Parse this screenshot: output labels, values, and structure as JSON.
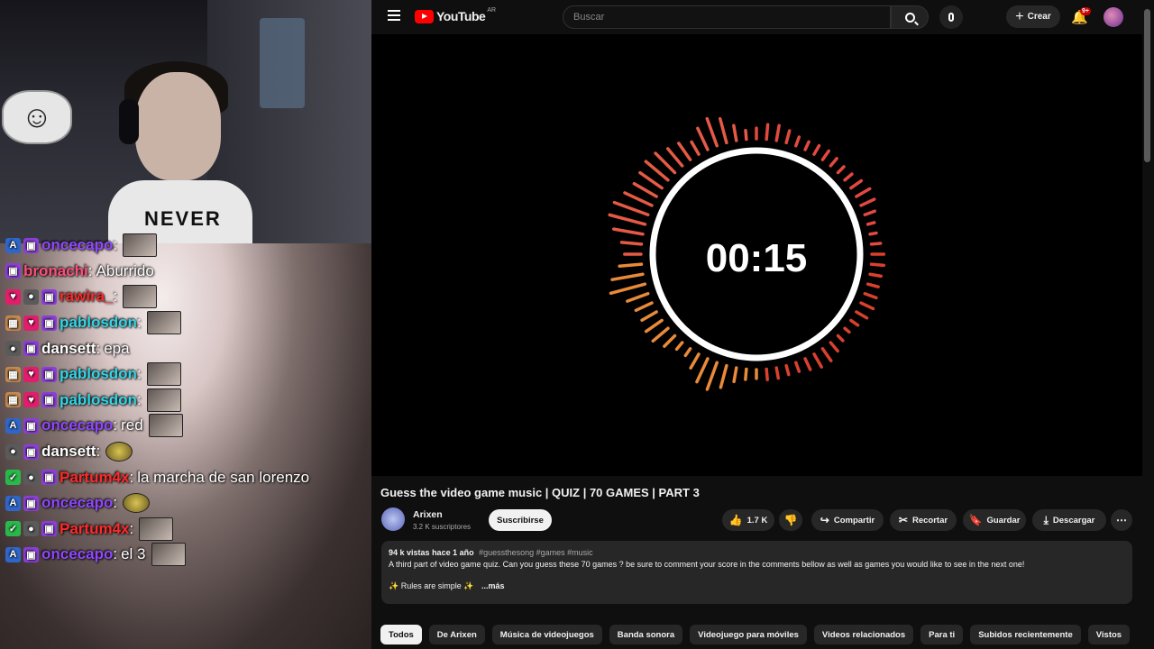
{
  "stream": {
    "shirt_text": "NEVER",
    "chat": [
      {
        "badges": [
          "sub",
          "twitch"
        ],
        "user": "oncecapo",
        "color": "#9147ff",
        "text": "",
        "emote": "photo"
      },
      {
        "badges": [
          "twitch"
        ],
        "user": "bronachi",
        "color": "#ff4f7a",
        "text": "Aburrido",
        "emote": ""
      },
      {
        "badges": [
          "pink",
          "dark",
          "twitch"
        ],
        "user": "rawira_",
        "color": "#ff2a2a",
        "text": "",
        "emote": "photo"
      },
      {
        "badges": [
          "gift",
          "pink",
          "twitch"
        ],
        "user": "pablosdon",
        "color": "#31d6e8",
        "text": "",
        "emote": "photo"
      },
      {
        "badges": [
          "dark",
          "twitch"
        ],
        "user": "dansett",
        "color": "#ffffff",
        "text": "epa",
        "emote": ""
      },
      {
        "badges": [
          "gift",
          "pink",
          "twitch"
        ],
        "user": "pablosdon",
        "color": "#31d6e8",
        "text": "",
        "emote": "photo"
      },
      {
        "badges": [
          "gift",
          "pink",
          "twitch"
        ],
        "user": "pablosdon",
        "color": "#31d6e8",
        "text": "",
        "emote": "photo"
      },
      {
        "badges": [
          "sub",
          "twitch"
        ],
        "user": "oncecapo",
        "color": "#9147ff",
        "text": "red",
        "emote": "photo"
      },
      {
        "badges": [
          "dark",
          "twitch"
        ],
        "user": "dansett",
        "color": "#ffffff",
        "text": "",
        "emote": "small"
      },
      {
        "badges": [
          "green",
          "dark",
          "twitch"
        ],
        "user": "Partum4x",
        "color": "#ff2a2a",
        "text": "la marcha de san lorenzo",
        "emote": ""
      },
      {
        "badges": [
          "sub",
          "twitch"
        ],
        "user": "oncecapo",
        "color": "#9147ff",
        "text": "",
        "emote": "small"
      },
      {
        "badges": [
          "green",
          "dark",
          "twitch"
        ],
        "user": "Partum4x",
        "color": "#ff2a2a",
        "text": "",
        "emote": "photo"
      },
      {
        "badges": [
          "sub",
          "twitch"
        ],
        "user": "oncecapo",
        "color": "#9147ff",
        "text": "el 3",
        "emote": "photo"
      }
    ]
  },
  "youtube": {
    "logo_text": "YouTube",
    "logo_country": "AR",
    "search_placeholder": "Buscar",
    "create_label": "Crear",
    "notif_count": "9+",
    "timer": "00:15",
    "video_title": "Guess the video game music | QUIZ | 70 GAMES | PART 3",
    "channel_name": "Arixen",
    "channel_subs": "3.2 K suscriptores",
    "subscribe_label": "Suscribirse",
    "likes": "1.7 K",
    "share_label": "Compartir",
    "clip_label": "Recortar",
    "save_label": "Guardar",
    "download_label": "Descargar",
    "views": "94 k vistas",
    "uploaded": "hace 1 año",
    "tags": "#guessthesong #games #music",
    "description": "A third part of video game quiz. Can you guess these 70 games ? be sure to comment your score in the comments bellow as well as games you would like to see in the next one!",
    "description_line2": "Rules are simple",
    "more_label": "...más",
    "chips": [
      "Todos",
      "De Arixen",
      "Música de videojuegos",
      "Banda sonora",
      "Videojuego para móviles",
      "Videos relacionados",
      "Para ti",
      "Subidos recientemente",
      "Vistos"
    ]
  }
}
